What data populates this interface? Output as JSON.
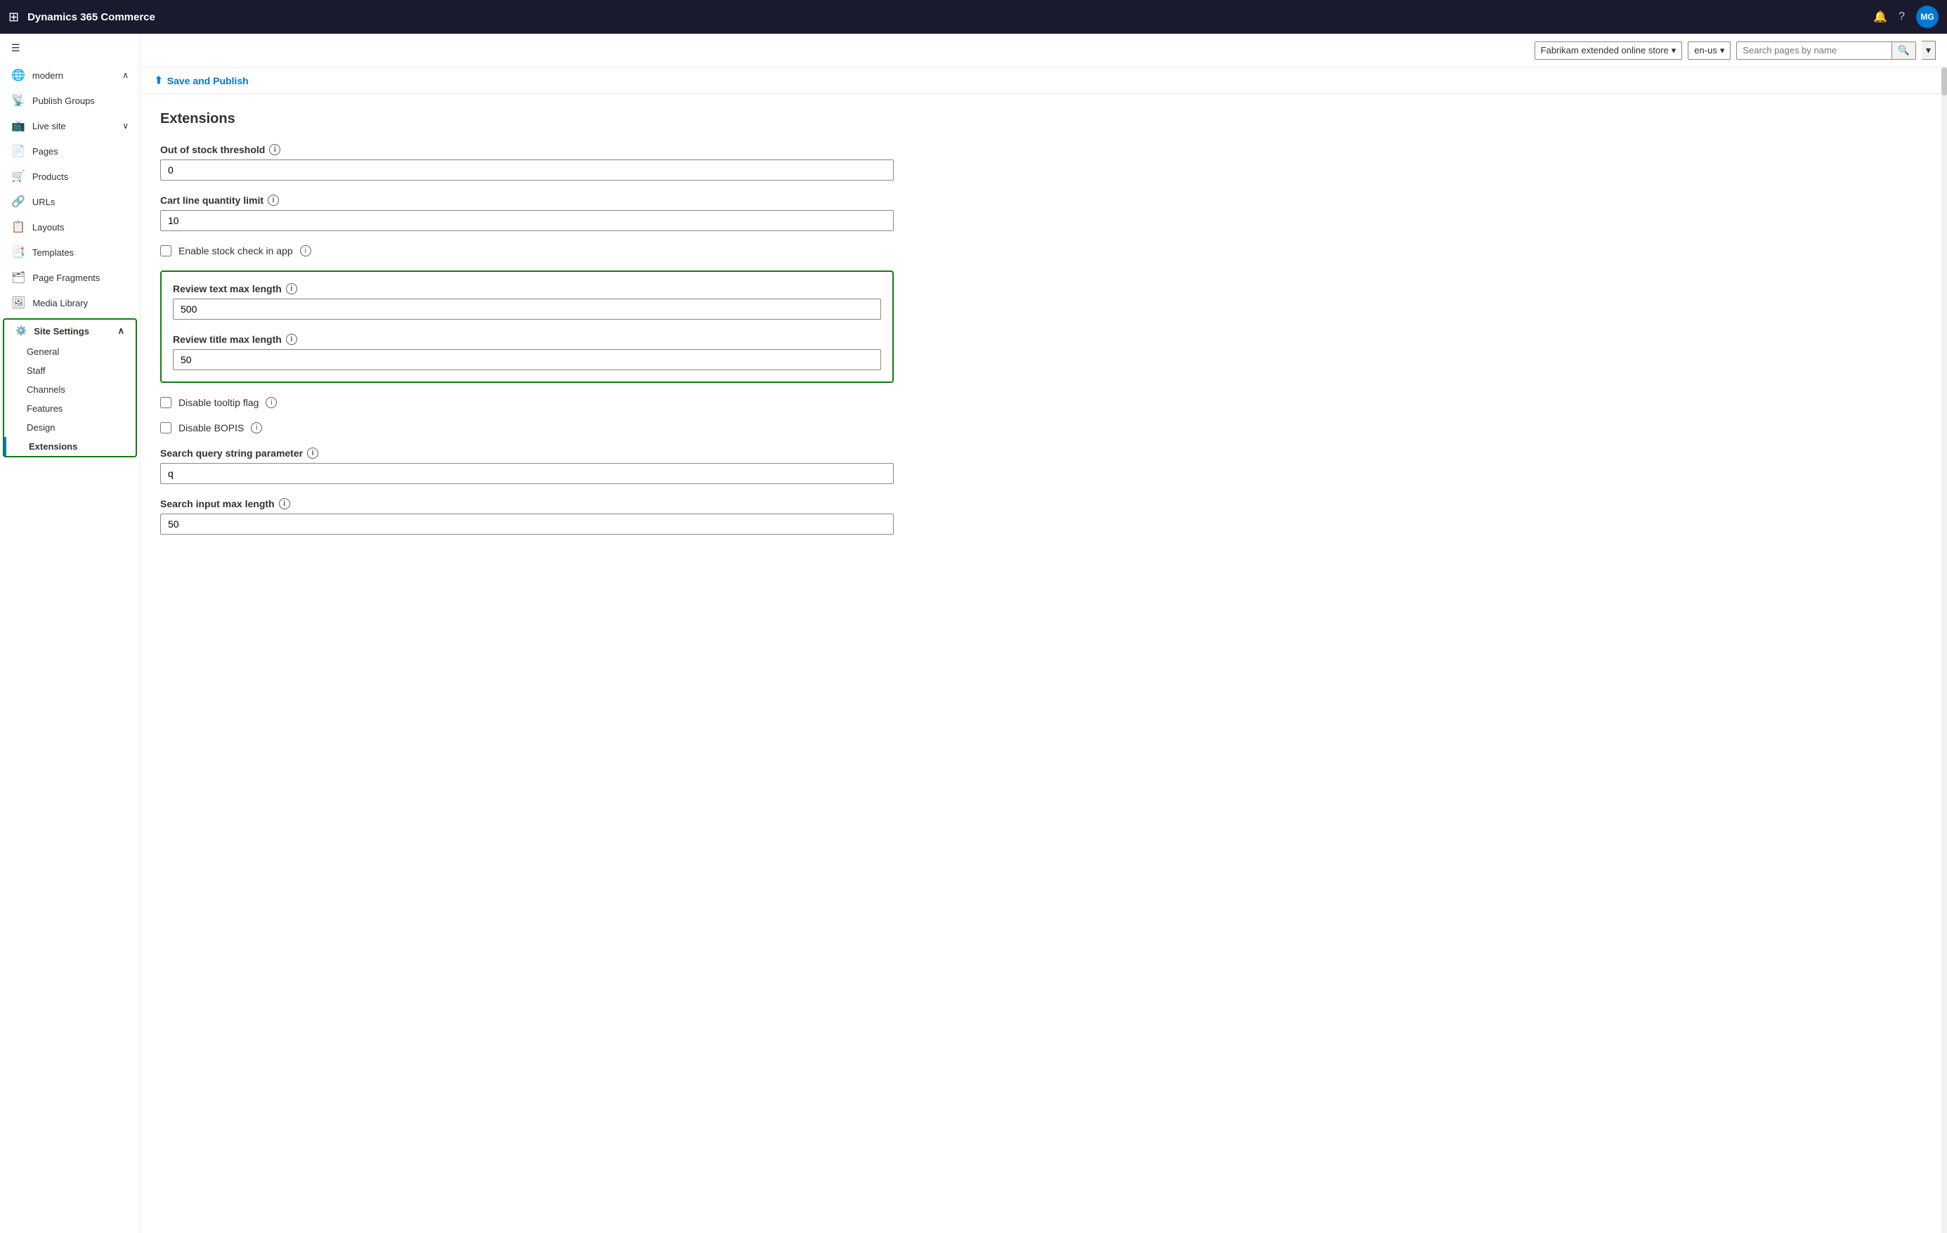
{
  "app": {
    "title": "Dynamics 365 Commerce"
  },
  "topbar": {
    "title": "Dynamics 365 Commerce",
    "avatar_initials": "MG"
  },
  "storebar": {
    "store_label": "Fabrikam extended online store",
    "locale_label": "en-us",
    "search_placeholder": "Search pages by name"
  },
  "sidebar": {
    "toggle_icon": "☰",
    "modern_label": "modern",
    "publish_groups_label": "Publish Groups",
    "live_site_label": "Live site",
    "pages_label": "Pages",
    "products_label": "Products",
    "urls_label": "URLs",
    "layouts_label": "Layouts",
    "templates_label": "Templates",
    "page_fragments_label": "Page Fragments",
    "media_library_label": "Media Library",
    "site_settings_label": "Site Settings",
    "general_label": "General",
    "staff_label": "Staff",
    "channels_label": "Channels",
    "features_label": "Features",
    "design_label": "Design",
    "extensions_label": "Extensions"
  },
  "action_bar": {
    "save_publish_label": "Save and Publish"
  },
  "page": {
    "title": "Extensions",
    "fields": [
      {
        "id": "out_of_stock_threshold",
        "label": "Out of stock threshold",
        "value": "0",
        "has_info": true
      },
      {
        "id": "cart_line_quantity_limit",
        "label": "Cart line quantity limit",
        "value": "10",
        "has_info": true
      },
      {
        "id": "review_text_max_length",
        "label": "Review text max length",
        "value": "500",
        "has_info": true,
        "highlighted": true
      },
      {
        "id": "review_title_max_length",
        "label": "Review title max length",
        "value": "50",
        "has_info": true,
        "highlighted": true
      },
      {
        "id": "search_query_string_parameter",
        "label": "Search query string parameter",
        "value": "q",
        "has_info": true
      },
      {
        "id": "search_input_max_length",
        "label": "Search input max length",
        "value": "50",
        "has_info": true
      }
    ],
    "checkboxes": [
      {
        "id": "enable_stock_check",
        "label": "Enable stock check in app",
        "checked": false,
        "has_info": true
      },
      {
        "id": "disable_tooltip_flag",
        "label": "Disable tooltip flag",
        "checked": false,
        "has_info": true
      },
      {
        "id": "disable_bopis",
        "label": "Disable BOPIS",
        "checked": false,
        "has_info": true
      }
    ]
  }
}
